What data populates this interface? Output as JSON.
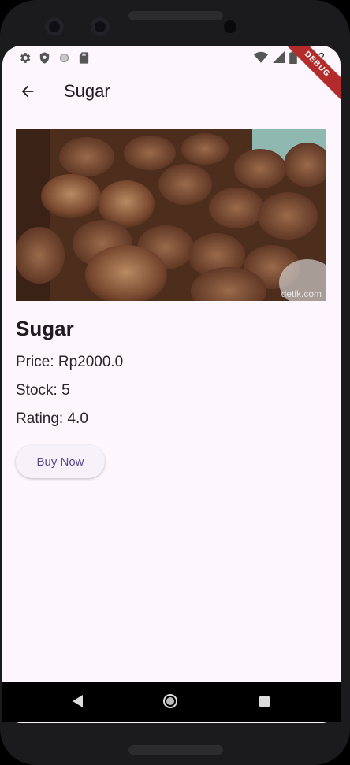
{
  "status_bar": {
    "time": "5:22",
    "debug_label": "DEBUG",
    "left_icons": [
      "settings-icon",
      "shield-icon",
      "circle-icon",
      "sd-card-icon"
    ],
    "right_icons": [
      "wifi-icon",
      "signal-icon",
      "battery-icon"
    ]
  },
  "app_bar": {
    "title": "Sugar",
    "back_icon": "arrow-back-icon"
  },
  "product": {
    "image_watermark": "detik.com",
    "name": "Sugar",
    "price": "Price: Rp2000.0",
    "stock": "Stock: 5",
    "rating": "Rating: 4.0",
    "buy_label": "Buy Now"
  },
  "nav_bar": {
    "icons": [
      "nav-back-icon",
      "nav-home-icon",
      "nav-recents-icon"
    ]
  },
  "colors": {
    "background": "#fdf7fd",
    "button_text": "#5a4a8e",
    "debug_banner": "#b32b2b"
  }
}
